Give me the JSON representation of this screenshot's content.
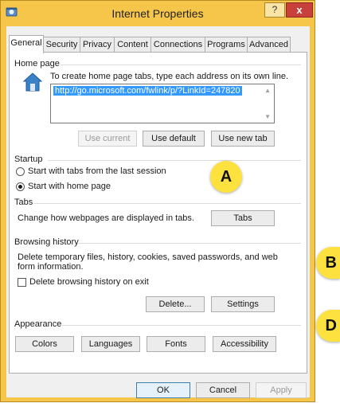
{
  "window": {
    "title": "Internet Properties",
    "help_button": "?",
    "close_button": "x"
  },
  "tabs": [
    {
      "label": "General",
      "active": true
    },
    {
      "label": "Security",
      "active": false
    },
    {
      "label": "Privacy",
      "active": false
    },
    {
      "label": "Content",
      "active": false
    },
    {
      "label": "Connections",
      "active": false
    },
    {
      "label": "Programs",
      "active": false
    },
    {
      "label": "Advanced",
      "active": false
    }
  ],
  "home_page": {
    "group_label": "Home page",
    "instruction": "To create home page tabs, type each address on its own line.",
    "url_value": "http://go.microsoft.com/fwlink/p/?LinkId=247820",
    "use_current": "Use current",
    "use_default": "Use default",
    "use_new_tab": "Use new tab"
  },
  "startup": {
    "group_label": "Startup",
    "option_last_session": "Start with tabs from the last session",
    "option_home_page": "Start with home page",
    "selected": "Start with home page"
  },
  "tabs_group": {
    "group_label": "Tabs",
    "description": "Change how webpages are displayed in tabs.",
    "button": "Tabs"
  },
  "browsing_history": {
    "group_label": "Browsing history",
    "description_line1": "Delete temporary files, history, cookies, saved passwords, and web",
    "description_line2": "form information.",
    "delete_on_exit": "Delete browsing history on exit",
    "delete_on_exit_checked": false,
    "delete_button": "Delete...",
    "settings_button": "Settings"
  },
  "appearance": {
    "group_label": "Appearance",
    "colors": "Colors",
    "languages": "Languages",
    "fonts": "Fonts",
    "accessibility": "Accessibility"
  },
  "dialog_buttons": {
    "ok": "OK",
    "cancel": "Cancel",
    "apply": "Apply"
  },
  "callouts": {
    "a": "A",
    "b": "B",
    "d": "D"
  },
  "colors": {
    "frame": "#f6c64a",
    "close_button": "#c7403b",
    "selection": "#3399ff",
    "callout": "#fde23f"
  }
}
